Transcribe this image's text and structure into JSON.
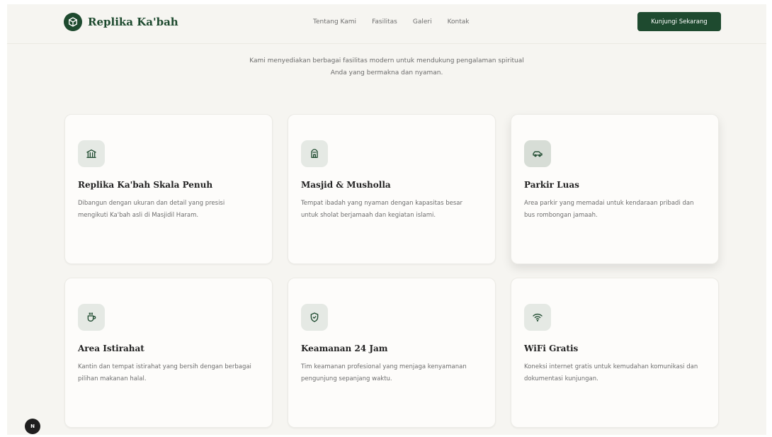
{
  "brand": {
    "name": "Replika Ka'bah",
    "color": "#1e4a2f"
  },
  "nav": {
    "items": [
      "Tentang Kami",
      "Fasilitas",
      "Galeri",
      "Kontak"
    ]
  },
  "cta": {
    "label": "Kunjungi Sekarang"
  },
  "intro": {
    "line1": "Kami menyediakan berbagai fasilitas modern untuk mendukung pengalaman spiritual",
    "line2": "Anda yang bermakna dan nyaman."
  },
  "facilities": [
    {
      "icon": "landmark-icon",
      "title": "Replika Ka'bah Skala Penuh",
      "description": "Dibangun dengan ukuran dan detail yang presisi mengikuti Ka'bah asli di Masjidil Haram."
    },
    {
      "icon": "mosque-icon",
      "title": "Masjid & Musholla",
      "description": "Tempat ibadah yang nyaman dengan kapasitas besar untuk sholat berjamaah dan kegiatan islami."
    },
    {
      "icon": "car-icon",
      "title": "Parkir Luas",
      "description": "Area parkir yang memadai untuk kendaraan pribadi dan bus rombongan jamaah."
    },
    {
      "icon": "coffee-icon",
      "title": "Area Istirahat",
      "description": "Kantin dan tempat istirahat yang bersih dengan berbagai pilihan makanan halal."
    },
    {
      "icon": "shield-icon",
      "title": "Keamanan 24 Jam",
      "description": "Tim keamanan profesional yang menjaga kenyamanan pengunjung sepanjang waktu."
    },
    {
      "icon": "wifi-icon",
      "title": "WiFi Gratis",
      "description": "Koneksi internet gratis untuk kemudahan komunikasi dan dokumentasi kunjungan."
    }
  ],
  "fab": {
    "label": "N"
  },
  "colors": {
    "accent": "#1e4a2f",
    "background": "#f6f5f1",
    "card": "#fdfcfa",
    "icon_tile": "#e5e9e4"
  }
}
